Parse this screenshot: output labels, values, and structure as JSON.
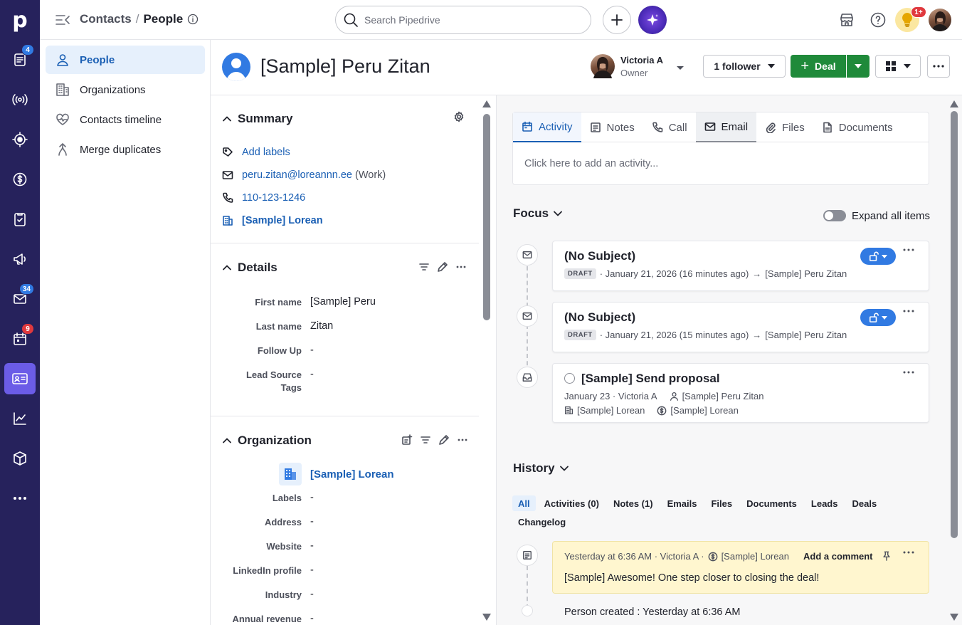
{
  "app": {
    "logo_letter": "p",
    "brand_color": "#26225c",
    "accent_color": "#1a5fb4"
  },
  "rail": {
    "items": [
      {
        "name": "leads-icon",
        "badge": "4",
        "badge_color": "#317ae2"
      },
      {
        "name": "broadcast-icon",
        "badge": ""
      },
      {
        "name": "target-icon",
        "badge": ""
      },
      {
        "name": "dollar-icon",
        "badge": ""
      },
      {
        "name": "checklist-icon",
        "badge": ""
      },
      {
        "name": "megaphone-icon",
        "badge": ""
      },
      {
        "name": "mail-icon",
        "badge": "34",
        "badge_color": "#317ae2"
      },
      {
        "name": "calendar-icon",
        "badge": "9",
        "badge_color": "#e0393e"
      },
      {
        "name": "contacts-card-icon",
        "badge": "",
        "active": true
      },
      {
        "name": "chart-icon",
        "badge": ""
      },
      {
        "name": "box-icon",
        "badge": ""
      },
      {
        "name": "more-dots-icon",
        "badge": ""
      }
    ]
  },
  "topbar": {
    "crumb_parent": "Contacts",
    "crumb_sep": "/",
    "crumb_current": "People",
    "search_placeholder": "Search Pipedrive",
    "notif_badge": "1+"
  },
  "subnav": {
    "items": [
      {
        "label": "People",
        "icon": "person-icon",
        "active": true
      },
      {
        "label": "Organizations",
        "icon": "building-icon"
      },
      {
        "label": "Contacts timeline",
        "icon": "heart-pulse-icon"
      },
      {
        "label": "Merge duplicates",
        "icon": "merge-icon"
      }
    ]
  },
  "header": {
    "person_name": "[Sample] Peru Zitan",
    "owner_name": "Victoria A",
    "owner_role": "Owner",
    "follower_label": "1 follower",
    "deal_label": "Deal",
    "deal_plus": "+"
  },
  "summary": {
    "title": "Summary",
    "add_labels": "Add labels",
    "email": "peru.zitan@loreannn.ee",
    "email_type": "(Work)",
    "phone": "110-123-1246",
    "org": "[Sample] Lorean"
  },
  "details": {
    "title": "Details",
    "fields": [
      {
        "label": "First name",
        "value": "[Sample] Peru"
      },
      {
        "label": "Last name",
        "value": "Zitan"
      },
      {
        "label": "Follow Up",
        "value": "-"
      },
      {
        "label_line1": "Lead Source",
        "label_line2": "Tags",
        "value": "-"
      }
    ]
  },
  "organization": {
    "title": "Organization",
    "name": "[Sample] Lorean",
    "fields": [
      {
        "label": "Labels",
        "value": "-"
      },
      {
        "label": "Address",
        "value": "-"
      },
      {
        "label": "Website",
        "value": "-"
      },
      {
        "label": "LinkedIn profile",
        "value": "-"
      },
      {
        "label": "Industry",
        "value": "-"
      },
      {
        "label": "Annual revenue",
        "value": "-"
      }
    ]
  },
  "composer": {
    "tabs": [
      "Activity",
      "Notes",
      "Call",
      "Email",
      "Files",
      "Documents"
    ],
    "placeholder": "Click here to add an activity..."
  },
  "focus": {
    "title": "Focus",
    "expand_label": "Expand all items",
    "items": [
      {
        "title": "(No Subject)",
        "badge": "DRAFT",
        "meta": "· January 21, 2026 (16 minutes ago)",
        "arrow": "→",
        "target": "[Sample] Peru Zitan"
      },
      {
        "title": "(No Subject)",
        "badge": "DRAFT",
        "meta": "· January 21, 2026 (15 minutes ago)",
        "arrow": "→",
        "target": "[Sample] Peru Zitan"
      }
    ],
    "activity": {
      "title": "[Sample] Send proposal",
      "date_owner": "January 23 · Victoria A",
      "person": "[Sample] Peru Zitan",
      "org": "[Sample] Lorean",
      "deal": "[Sample] Lorean"
    }
  },
  "history": {
    "title": "History",
    "tabs": [
      "All",
      "Activities (0)",
      "Notes (1)",
      "Emails",
      "Files",
      "Documents",
      "Leads",
      "Deals",
      "Changelog"
    ],
    "note": {
      "meta": "Yesterday at 6:36 AM · Victoria A ·",
      "deal": "[Sample] Lorean",
      "add_comment": "Add a comment",
      "text": "[Sample] Awesome! One step closer to closing the deal!"
    },
    "created": "Person created : Yesterday at 6:36 AM"
  }
}
